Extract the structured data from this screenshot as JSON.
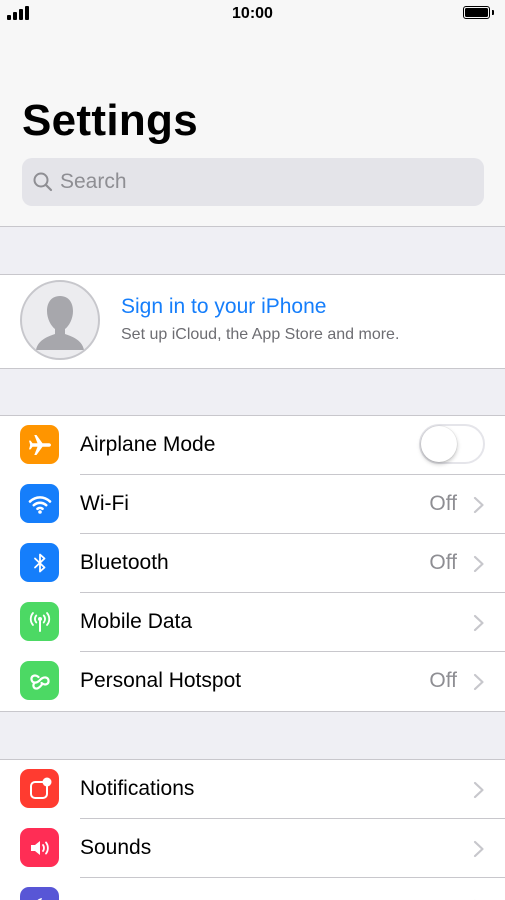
{
  "status_bar": {
    "time": "10:00",
    "signal_icon": "cellular-signal-icon",
    "battery_icon": "battery-full-icon",
    "battery_level": 1.0
  },
  "header": {
    "title": "Settings",
    "search_placeholder": "Search",
    "search_value": ""
  },
  "profile": {
    "title": "Sign in to your iPhone",
    "subtitle": "Set up iCloud, the App Store and more.",
    "icon": "person-silhouette-icon"
  },
  "connectivity": [
    {
      "label": "Airplane Mode",
      "value": "",
      "icon": "airplane-icon",
      "color": "#ff9500",
      "control": "toggle",
      "on": false
    },
    {
      "label": "Wi-Fi",
      "value": "Off",
      "icon": "wifi-icon",
      "color": "#157efb",
      "control": "chevron"
    },
    {
      "label": "Bluetooth",
      "value": "Off",
      "icon": "bluetooth-icon",
      "color": "#157efb",
      "control": "chevron"
    },
    {
      "label": "Mobile Data",
      "value": "",
      "icon": "antenna-icon",
      "color": "#4cd964",
      "control": "chevron"
    },
    {
      "label": "Personal Hotspot",
      "value": "Off",
      "icon": "hotspot-icon",
      "color": "#4cd964",
      "control": "chevron"
    }
  ],
  "system": [
    {
      "label": "Notifications",
      "value": "",
      "icon": "notifications-icon",
      "color": "#ff3b30",
      "control": "chevron"
    },
    {
      "label": "Sounds",
      "value": "",
      "icon": "speaker-icon",
      "color": "#ff2d55",
      "control": "chevron"
    },
    {
      "label": "",
      "value": "",
      "icon": "moon-icon",
      "color": "#5856d6",
      "control": "chevron"
    }
  ],
  "colors": {
    "accent": "#157efb",
    "background": "#efeff4",
    "separator": "#c8c7cc",
    "secondary_text": "#8e8e93"
  }
}
